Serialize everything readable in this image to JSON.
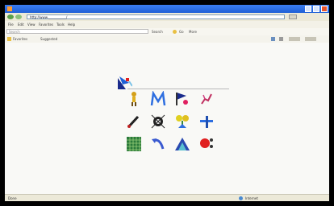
{
  "window": {
    "title": "",
    "address_url": "http://www.___________/",
    "status_left": "Done",
    "status_zone": "Internet",
    "status_zoom": ""
  },
  "menu": {
    "items": [
      "File",
      "Edit",
      "View",
      "Favorites",
      "Tools",
      "Help"
    ]
  },
  "toolbar": {
    "search_placeholder": "Search",
    "items": [
      "Search",
      "Go",
      "More"
    ]
  },
  "bookmarks": {
    "items": [
      "Favorites",
      "Suggested"
    ]
  },
  "page": {
    "caption": "",
    "icons": [
      "logo-mark",
      "figure-icon",
      "m-letter-icon",
      "flag-icon",
      "runner-icon",
      "pen-icon",
      "splat-icon",
      "flower-icon",
      "hammer-icon",
      "grid-icon",
      "arrow-icon",
      "triangle-icon",
      "red-dots-icon"
    ]
  }
}
